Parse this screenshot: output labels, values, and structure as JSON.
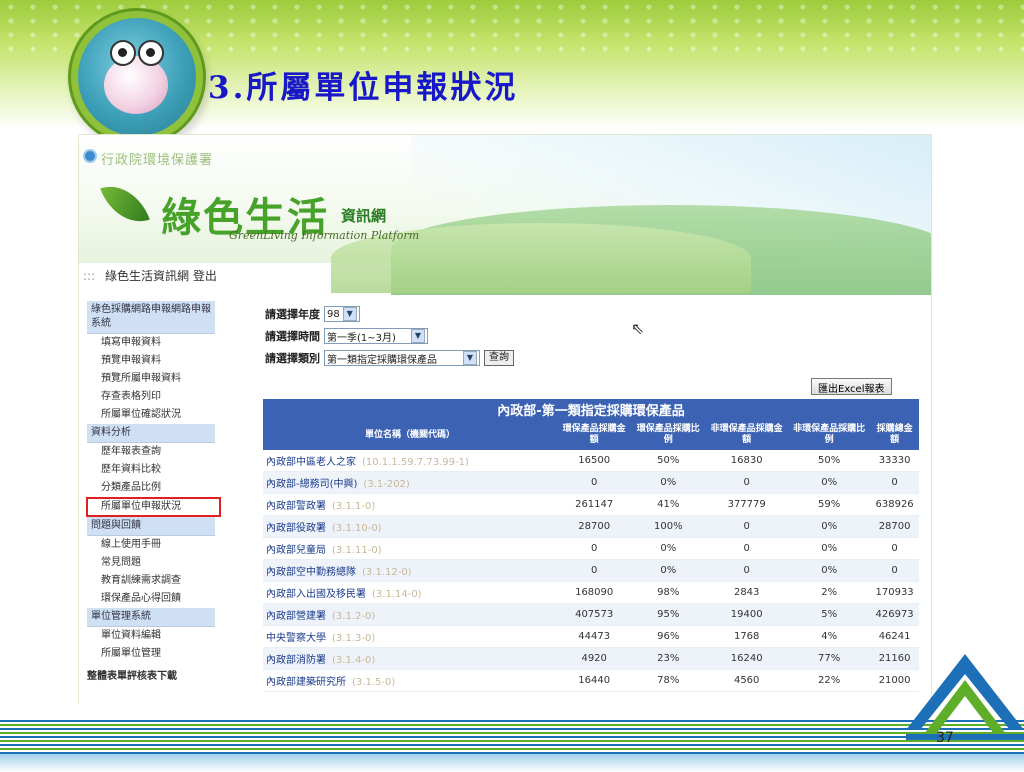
{
  "slide": {
    "title": "3.所屬單位申報狀況",
    "page_number": "37"
  },
  "site": {
    "agency": "行政院環境保護署",
    "brand": "綠色生活",
    "brand_sub": "資訊網",
    "brand_en": "GreenLiving Information Platform",
    "breadcrumb_sep": ":::",
    "breadcrumb_site": "綠色生活資訊網",
    "logout": "登出"
  },
  "sidebar": [
    {
      "group": "綠色採購網路申報網路申報系統"
    },
    {
      "item": "填寫申報資料"
    },
    {
      "item": "預覽申報資料"
    },
    {
      "item": "預覽所屬申報資料"
    },
    {
      "item": "存查表格列印"
    },
    {
      "item": "所屬單位確認狀況"
    },
    {
      "group": "資料分析"
    },
    {
      "item": "歷年報表查詢"
    },
    {
      "item": "歷年資料比較"
    },
    {
      "item": "分類產品比例"
    },
    {
      "item": "所屬單位申報狀況",
      "highlight": true
    },
    {
      "group": "問題與回饋"
    },
    {
      "item": "線上使用手冊"
    },
    {
      "item": "常見問題"
    },
    {
      "item": "教育訓練需求調查"
    },
    {
      "item": "環保產品心得回饋"
    },
    {
      "group": "單位管理系統"
    },
    {
      "item": "單位資料編輯"
    },
    {
      "item": "所屬單位管理"
    },
    {
      "bottom": "整體表單評核表下載"
    }
  ],
  "filters": {
    "year_label": "請選擇年度",
    "year_value": "98",
    "period_label": "請選擇時間",
    "period_value": "第一季(1~3月)",
    "category_label": "請選擇類別",
    "category_value": "第一類指定採購環保產品",
    "query_button": "查詢",
    "excel_button": "匯出Excel報表"
  },
  "table": {
    "title": "內政部-第一類指定採購環保產品",
    "headers": [
      "單位名稱（機關代碼）",
      "環保產品採購金額",
      "環保產品採購比例",
      "非環保產品採購金額",
      "非環保產品採購比例",
      "採購總金額"
    ],
    "rows": [
      {
        "name": "內政部中區老人之家",
        "code": "(10.1.1.59.7.73.99-1)",
        "eco_amt": "16500",
        "eco_pct": "50%",
        "non_amt": "16830",
        "non_pct": "50%",
        "total": "33330"
      },
      {
        "name": "內政部-總務司(中興)",
        "code": "(3.1-202)",
        "eco_amt": "0",
        "eco_pct": "0%",
        "non_amt": "0",
        "non_pct": "0%",
        "total": "0"
      },
      {
        "name": "內政部警政署",
        "code": "(3.1.1-0)",
        "eco_amt": "261147",
        "eco_pct": "41%",
        "non_amt": "377779",
        "non_pct": "59%",
        "total": "638926"
      },
      {
        "name": "內政部役政署",
        "code": "(3.1.10-0)",
        "eco_amt": "28700",
        "eco_pct": "100%",
        "non_amt": "0",
        "non_pct": "0%",
        "total": "28700"
      },
      {
        "name": "內政部兒童局",
        "code": "(3.1.11-0)",
        "eco_amt": "0",
        "eco_pct": "0%",
        "non_amt": "0",
        "non_pct": "0%",
        "total": "0"
      },
      {
        "name": "內政部空中勤務總隊",
        "code": "(3.1.12-0)",
        "eco_amt": "0",
        "eco_pct": "0%",
        "non_amt": "0",
        "non_pct": "0%",
        "total": "0"
      },
      {
        "name": "內政部入出國及移民署",
        "code": "(3.1.14-0)",
        "eco_amt": "168090",
        "eco_pct": "98%",
        "non_amt": "2843",
        "non_pct": "2%",
        "total": "170933"
      },
      {
        "name": "內政部營建署",
        "code": "(3.1.2-0)",
        "eco_amt": "407573",
        "eco_pct": "95%",
        "non_amt": "19400",
        "non_pct": "5%",
        "total": "426973"
      },
      {
        "name": "中央警察大學",
        "code": "(3.1.3-0)",
        "eco_amt": "44473",
        "eco_pct": "96%",
        "non_amt": "1768",
        "non_pct": "4%",
        "total": "46241"
      },
      {
        "name": "內政部消防署",
        "code": "(3.1.4-0)",
        "eco_amt": "4920",
        "eco_pct": "23%",
        "non_amt": "16240",
        "non_pct": "77%",
        "total": "21160"
      },
      {
        "name": "內政部建築研究所",
        "code": "(3.1.5-0)",
        "eco_amt": "16440",
        "eco_pct": "78%",
        "non_amt": "4560",
        "non_pct": "22%",
        "total": "21000"
      }
    ]
  },
  "colors": {
    "title": "#1818c8",
    "table_header": "#3b62b3",
    "highlight_box": "#e02020",
    "brand": "#47a22a"
  },
  "icons": {
    "cursor": "mouse-pointer-icon",
    "dropdown": "chevron-down-icon"
  }
}
